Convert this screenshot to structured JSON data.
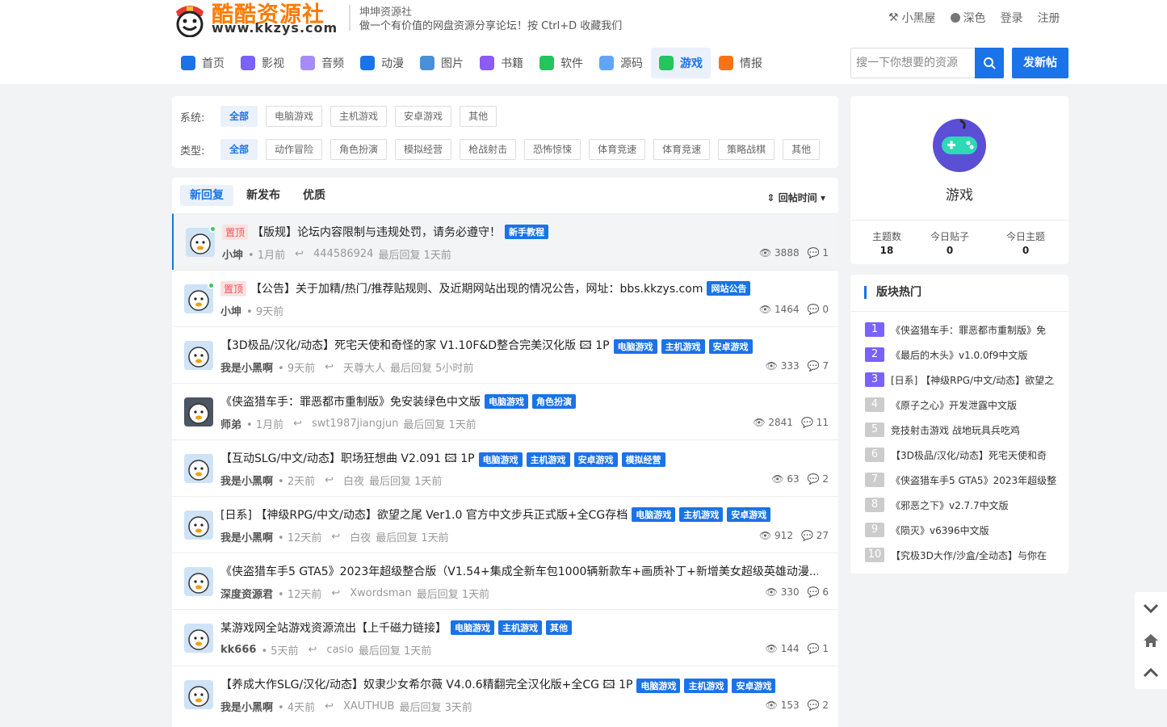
{
  "brand": {
    "name": "酷酷资源社",
    "url": "www.kkzys.com",
    "title": "坤坤资源社",
    "subtitle": "做一个有价值的网盘资源分享论坛！按 Ctrl+D 收藏我们"
  },
  "toplinks": [
    "小黑屋",
    "深色",
    "登录",
    "注册"
  ],
  "nav": [
    {
      "label": "首页",
      "color": "#1a73e8"
    },
    {
      "label": "影视",
      "color": "#7b61ff"
    },
    {
      "label": "音频",
      "color": "#a78bfa"
    },
    {
      "label": "动漫",
      "color": "#1a73e8"
    },
    {
      "label": "图片",
      "color": "#4a90d9"
    },
    {
      "label": "书籍",
      "color": "#8b5cf6"
    },
    {
      "label": "软件",
      "color": "#22c55e"
    },
    {
      "label": "源码",
      "color": "#60a5fa"
    },
    {
      "label": "游戏",
      "color": "#22c55e"
    },
    {
      "label": "情报",
      "color": "#f97316"
    }
  ],
  "search": {
    "placeholder": "搜一下你想要的资源"
  },
  "post_button": "发新帖",
  "filters": {
    "system_label": "系统:",
    "system": [
      "全部",
      "电脑游戏",
      "主机游戏",
      "安卓游戏",
      "其他"
    ],
    "type_label": "类型:",
    "type": [
      "全部",
      "动作冒险",
      "角色扮演",
      "模拟经营",
      "枪战射击",
      "恐怖惊悚",
      "体育竞速",
      "体育竞速",
      "策略战棋",
      "其他"
    ]
  },
  "tabs": [
    "新回复",
    "新发布",
    "优质"
  ],
  "sort_label": "回帖时间",
  "threads": [
    {
      "pin": "置顶",
      "title": "【版规】论坛内容限制与违规处罚，请务必遵守！",
      "tags": [
        "新手教程"
      ],
      "author": "小坤",
      "time": "• 1月前",
      "replier": "444586924",
      "last": "最后回复 1天前",
      "views": "3888",
      "replies": "1"
    },
    {
      "pin": "置顶",
      "title": "【公告】关于加精/热门/推荐贴规则、及近期网站出现的情况公告，网址：bbs.kkzys.com",
      "tags": [
        "网站公告"
      ],
      "author": "小坤",
      "time": "• 9天前",
      "replier": "",
      "last": "",
      "views": "1464",
      "replies": "0"
    },
    {
      "pin": "",
      "title": "【3D极品/汉化/动态】死宅天使和奇怪的家 V1.10F&D整合完美汉化版 🖾 1P",
      "tags": [
        "电脑游戏",
        "主机游戏",
        "安卓游戏"
      ],
      "author": "我是小黑啊",
      "time": "• 9天前",
      "replier": "天尊大人",
      "last": "最后回复 5小时前",
      "views": "333",
      "replies": "7"
    },
    {
      "pin": "",
      "title": "《侠盗猎车手：罪恶都市重制版》免安装绿色中文版",
      "tags": [
        "电脑游戏",
        "角色扮演"
      ],
      "author": "师弟",
      "time": "• 1月前",
      "replier": "swt1987jiangjun",
      "last": "最后回复 1天前",
      "views": "2841",
      "replies": "11"
    },
    {
      "pin": "",
      "title": "【互动SLG/中文/动态】职场狂想曲 V2.091 🖾 1P",
      "tags": [
        "电脑游戏",
        "主机游戏",
        "安卓游戏",
        "模拟经营"
      ],
      "author": "我是小黑啊",
      "time": "• 2天前",
      "replier": "白夜",
      "last": "最后回复 1天前",
      "views": "63",
      "replies": "2"
    },
    {
      "pin": "",
      "title": "[日系] 【神级RPG/中文/动态】欲望之尾 Ver1.0 官方中文步兵正式版+全CG存档",
      "tags": [
        "电脑游戏",
        "主机游戏",
        "安卓游戏"
      ],
      "author": "我是小黑啊",
      "time": "• 12天前",
      "replier": "白夜",
      "last": "最后回复 1天前",
      "views": "912",
      "replies": "27"
    },
    {
      "pin": "",
      "title": "《侠盗猎车手5 GTA5》2023年超级整合版（V1.54+集成全新车包1000辆新款车+画质补丁+新增美女超级英雄动漫...",
      "tags": [],
      "author": "深度资源君",
      "time": "• 12天前",
      "replier": "Xwordsman",
      "last": "最后回复 1天前",
      "views": "330",
      "replies": "6"
    },
    {
      "pin": "",
      "title": "某游戏网全站游戏资源流出【上千磁力链接】",
      "tags": [
        "电脑游戏",
        "主机游戏",
        "其他"
      ],
      "author": "kk666",
      "time": "• 5天前",
      "replier": "casio",
      "last": "最后回复 1天前",
      "views": "144",
      "replies": "1"
    },
    {
      "pin": "",
      "title": "【养成大作SLG/汉化/动态】奴隶少女希尔薇 V4.0.6精翻完全汉化版+全CG 🖾 1P",
      "tags": [
        "电脑游戏",
        "主机游戏",
        "安卓游戏"
      ],
      "author": "我是小黑啊",
      "time": "• 4天前",
      "replier": "XAUTHUB",
      "last": "最后回复 3天前",
      "views": "153",
      "replies": "2"
    }
  ],
  "forum": {
    "name": "游戏",
    "stats": [
      {
        "label": "主题数",
        "value": "18"
      },
      {
        "label": "今日贴子",
        "value": "0"
      },
      {
        "label": "今日主题",
        "value": "0"
      }
    ]
  },
  "hot_title": "版块热门",
  "hot": [
    {
      "n": "1",
      "text": "《侠盗猎车手：罪恶都市重制版》免",
      "color": "#7b61ff"
    },
    {
      "n": "2",
      "text": "《最后的木头》v1.0.0f9中文版",
      "color": "#7b61ff"
    },
    {
      "n": "3",
      "text": "[日系] 【神级RPG/中文/动态】欲望之",
      "color": "#7b61ff"
    },
    {
      "n": "4",
      "text": "《原子之心》开发泄露中文版",
      "color": "#cccccc"
    },
    {
      "n": "5",
      "text": "竞技射击游戏 战地玩具兵吃鸡",
      "color": "#cccccc"
    },
    {
      "n": "6",
      "text": "【3D极品/汉化/动态】死宅天使和奇",
      "color": "#cccccc"
    },
    {
      "n": "7",
      "text": "《侠盗猎车手5 GTA5》2023年超级整",
      "color": "#cccccc"
    },
    {
      "n": "8",
      "text": "《邪恶之下》v2.7.7中文版",
      "color": "#cccccc"
    },
    {
      "n": "9",
      "text": "《陨灭》v6396中文版",
      "color": "#cccccc"
    },
    {
      "n": "10",
      "text": "【究极3D大作/沙盒/全动态】与你在",
      "color": "#cccccc"
    }
  ]
}
